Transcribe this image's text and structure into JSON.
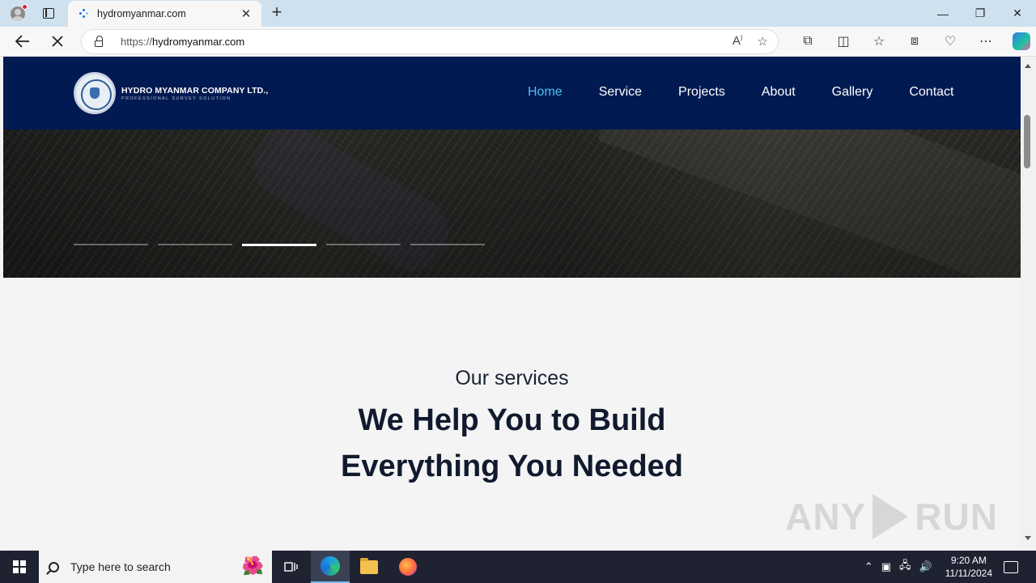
{
  "browser": {
    "tab_title": "hydromyanmar.com",
    "tab_close": "✕",
    "new_tab": "+",
    "window": {
      "minimize": "—",
      "restore": "❐",
      "close": "✕"
    },
    "url_scheme": "https://",
    "url_host": "hydromyanmar.com",
    "icons": [
      "profile-icon",
      "tab-actions-icon",
      "back-icon",
      "stop-loading-icon",
      "lock-icon",
      "read-aloud-icon",
      "favorite-star-icon",
      "extensions-icon",
      "split-screen-icon",
      "favorites-icon",
      "collections-icon",
      "browser-essentials-icon",
      "more-icon",
      "copilot-icon"
    ]
  },
  "site": {
    "logo_name": "HYDRO MYANMAR COMPANY LTD.,",
    "logo_tagline": "PROFESSIONAL SURVEY SOLUTION",
    "nav": [
      {
        "label": "Home",
        "active": true
      },
      {
        "label": "Service",
        "active": false
      },
      {
        "label": "Projects",
        "active": false
      },
      {
        "label": "About",
        "active": false
      },
      {
        "label": "Gallery",
        "active": false
      },
      {
        "label": "Contact",
        "active": false
      }
    ],
    "accent_color": "#4fc0f0",
    "header_color": "#021a52",
    "slider": {
      "count": 5,
      "active_index": 2
    },
    "services": {
      "kicker": "Our services",
      "heading_line1": "We Help You to Build",
      "heading_line2": "Everything You Needed"
    }
  },
  "watermark": {
    "left": "ANY",
    "right": "RUN"
  },
  "taskbar": {
    "search_placeholder": "Type here to search",
    "time": "9:20 AM",
    "date": "11/11/2024"
  }
}
